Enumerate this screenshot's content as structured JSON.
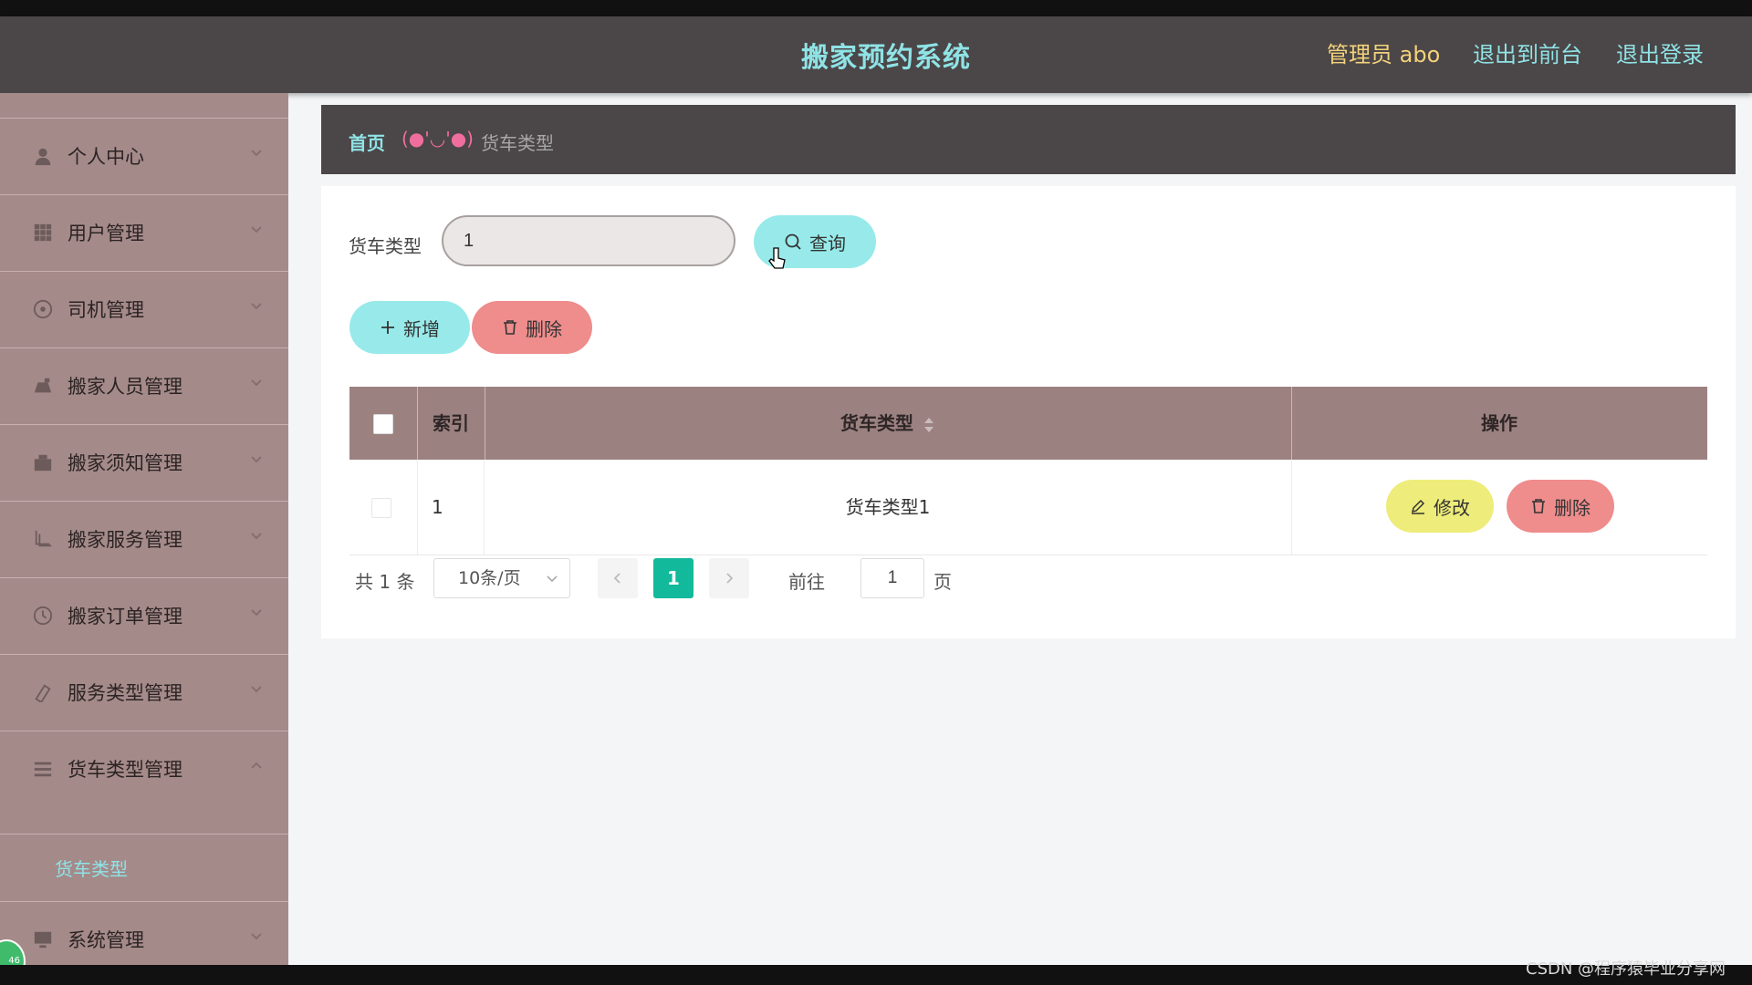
{
  "header": {
    "title": "搬家预约系统",
    "user": "管理员 abo",
    "front_link": "退出到前台",
    "logout_link": "退出登录"
  },
  "sidebar": {
    "items": [
      {
        "label": "个人中心",
        "icon": "user-icon"
      },
      {
        "label": "用户管理",
        "icon": "grid-icon"
      },
      {
        "label": "司机管理",
        "icon": "driver-icon"
      },
      {
        "label": "搬家人员管理",
        "icon": "worker-icon"
      },
      {
        "label": "搬家须知管理",
        "icon": "notice-icon"
      },
      {
        "label": "搬家服务管理",
        "icon": "service-icon"
      },
      {
        "label": "搬家订单管理",
        "icon": "order-icon"
      },
      {
        "label": "服务类型管理",
        "icon": "type-icon"
      },
      {
        "label": "货车类型管理",
        "icon": "truck-icon"
      },
      {
        "label": "系统管理",
        "icon": "system-icon"
      }
    ],
    "active_sub": "货车类型",
    "badge": "46"
  },
  "breadcrumb": {
    "home": "首页",
    "face": "(●'◡'●)",
    "current": "货车类型"
  },
  "search": {
    "label": "货车类型",
    "value": "1",
    "query_button": "查询"
  },
  "actions": {
    "add_button": "新增",
    "delete_button": "删除"
  },
  "table": {
    "columns": [
      "索引",
      "货车类型",
      "操作"
    ],
    "rows": [
      {
        "index": "1",
        "type": "货车类型1",
        "edit": "修改",
        "delete": "删除"
      }
    ]
  },
  "pagination": {
    "total": "共 1 条",
    "page_size": "10条/页",
    "current_page": "1",
    "goto_label": "前往",
    "goto_value": "1",
    "page_suffix": "页"
  },
  "watermark": "CSDN @程序猿毕业分享网",
  "colors": {
    "header_bg": "#4b4647",
    "sidebar_bg": "#a58a8a",
    "accent_cyan": "#98eaea",
    "danger": "#ef8c8c",
    "edit": "#eeec7a",
    "pager_active": "#12b99b"
  }
}
